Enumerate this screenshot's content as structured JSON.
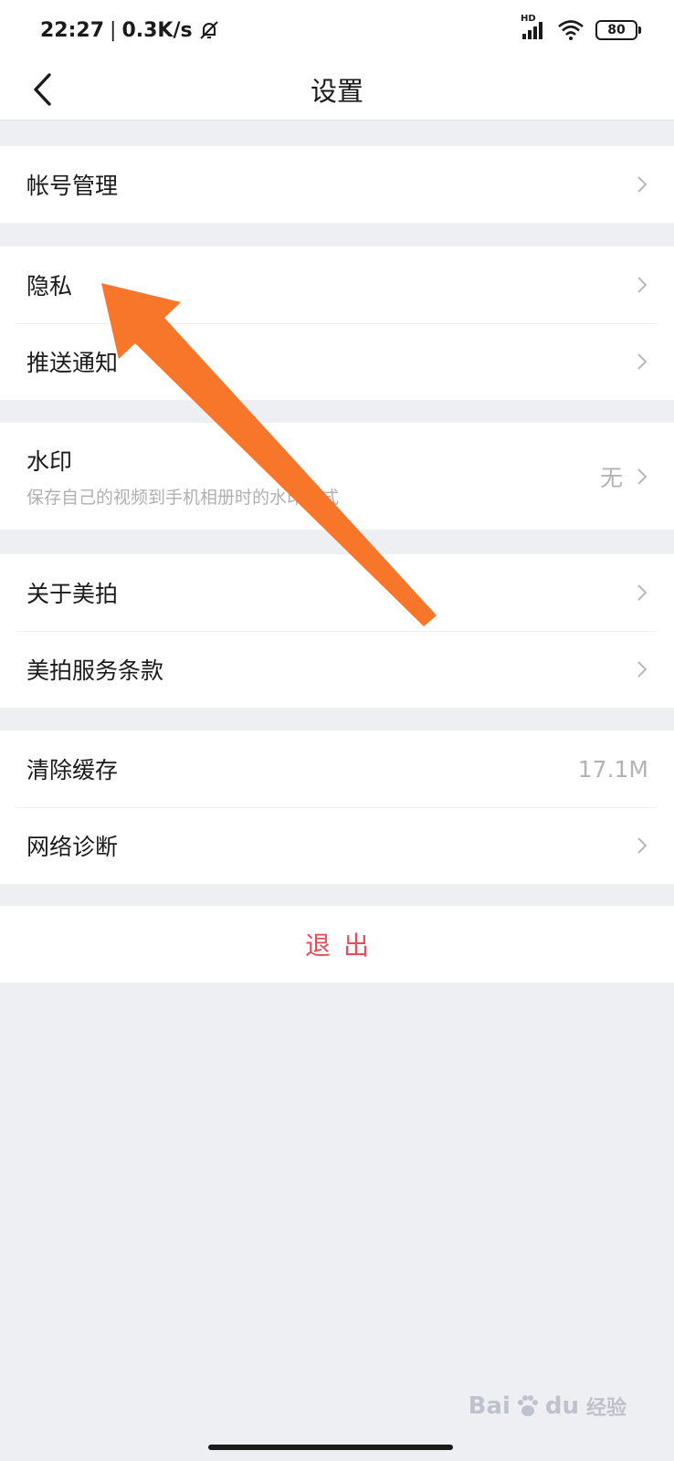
{
  "status_bar": {
    "time": "22:27",
    "net_speed": "0.3K/s",
    "signal_tag": "HD",
    "battery": "80"
  },
  "nav": {
    "title": "设置"
  },
  "groups": {
    "account": {
      "label": "帐号管理"
    },
    "privacy": {
      "label": "隐私"
    },
    "push": {
      "label": "推送通知"
    },
    "watermark": {
      "label": "水印",
      "sub": "保存自己的视频到手机相册时的水印样式",
      "value": "无"
    },
    "about": {
      "label": "关于美拍"
    },
    "terms": {
      "label": "美拍服务条款"
    },
    "cache": {
      "label": "清除缓存",
      "value": "17.1M"
    },
    "network": {
      "label": "网络诊断"
    }
  },
  "logout": {
    "label": "退出"
  },
  "overlay": {
    "watermark_text": "Bai",
    "watermark_text2": "du",
    "watermark_cn": "经验",
    "arrow_color": "#f7762a"
  },
  "icons": [
    "back-icon",
    "chevron-right-icon",
    "bell-off-icon",
    "signal-icon",
    "wifi-icon",
    "battery-icon"
  ]
}
